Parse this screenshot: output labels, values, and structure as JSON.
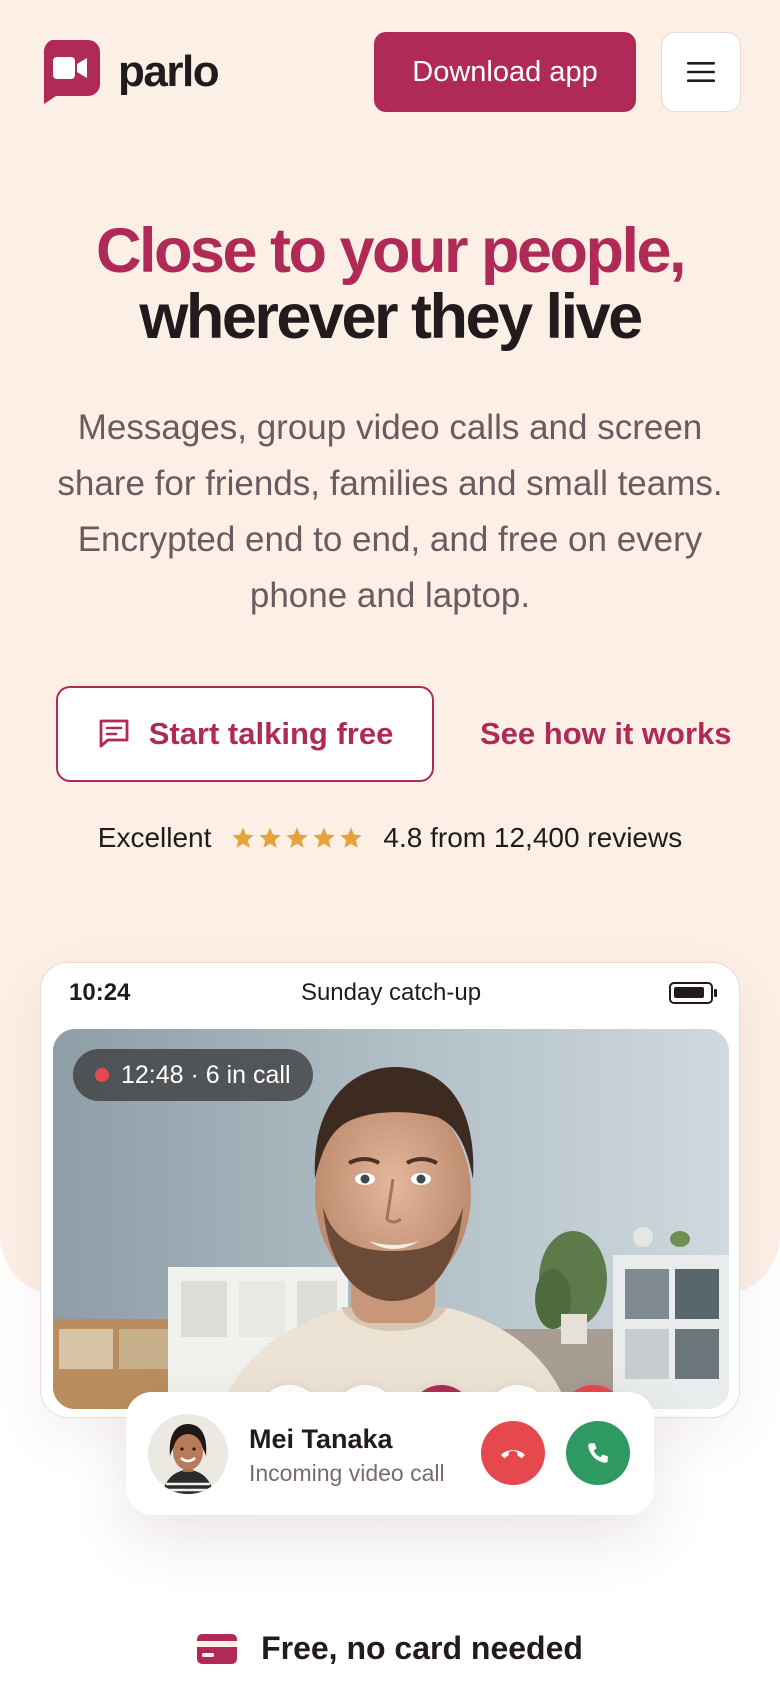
{
  "brand": {
    "name": "parlo",
    "accent": "#b02a58",
    "background": "#fcefe5"
  },
  "header": {
    "logo_icon": "video-bubble-icon",
    "download_label": "Download app",
    "menu_icon": "hamburger-menu-icon"
  },
  "hero": {
    "headline_line1": "Close to your people,",
    "headline_line2": "wherever they live",
    "subtext": "Messages, group video calls and screen share for friends, families and small teams. Encrypted end to end, and free on every phone and laptop.",
    "cta_primary": {
      "label": "Start talking free",
      "icon": "chat-icon"
    },
    "cta_secondary": {
      "label": "See how it works"
    }
  },
  "rating": {
    "label": "Excellent",
    "stars": 5,
    "summary": "4.8 from 12,400 reviews",
    "star_color": "#e6a23c"
  },
  "call_preview": {
    "status_time": "10:24",
    "title": "Sunday catch-up",
    "battery_icon": "battery-icon",
    "recording": "12:48 · 6 in call",
    "controls": [
      {
        "name": "mic-button",
        "icon": "microphone-icon"
      },
      {
        "name": "camera-button",
        "icon": "video-camera-icon"
      },
      {
        "name": "screen-share-button",
        "icon": "screen-share-icon",
        "active": true
      },
      {
        "name": "chat-button",
        "icon": "chat-icon"
      },
      {
        "name": "end-call-button",
        "icon": "phone-hangup-icon"
      }
    ]
  },
  "incoming_call": {
    "name": "Mei Tanaka",
    "subtitle": "Incoming video call",
    "decline_icon": "phone-hangup-icon",
    "accept_icon": "phone-icon",
    "decline_color": "#e5484d",
    "accept_color": "#2e9a62"
  },
  "footer_note": {
    "icon": "credit-card-icon",
    "text": "Free, no card needed"
  }
}
